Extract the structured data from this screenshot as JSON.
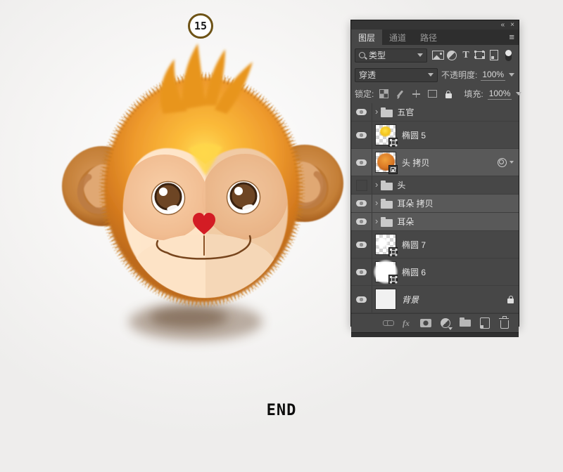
{
  "annotation": {
    "step_number": "15",
    "end_label": "END"
  },
  "panel": {
    "window_controls": {
      "collapse": "«",
      "close": "×",
      "menu": "≡"
    },
    "tabs": [
      {
        "label": "图层",
        "active": true
      },
      {
        "label": "通道",
        "active": false
      },
      {
        "label": "路径",
        "active": false
      }
    ],
    "filter": {
      "kind_label": "类型",
      "icons": [
        {
          "name": "pixel-filter"
        },
        {
          "name": "adjustment-filter"
        },
        {
          "name": "type-filter",
          "glyph": "T"
        },
        {
          "name": "shape-filter"
        },
        {
          "name": "smart-object-filter"
        },
        {
          "name": "filter-toggle"
        }
      ]
    },
    "blend": {
      "mode": "穿透",
      "opacity_label": "不透明度:",
      "opacity_value": "100%"
    },
    "lock": {
      "label": "锁定:",
      "icons": [
        "lock-transparent",
        "lock-paint",
        "lock-move",
        "lock-artboard",
        "lock-all"
      ],
      "fill_label": "填充:",
      "fill_value": "100%"
    },
    "layers": [
      {
        "name": "五官",
        "kind": "group",
        "visible": true,
        "selected": false
      },
      {
        "name": "椭圆 5",
        "kind": "layer",
        "visible": true,
        "selected": false,
        "thumb": "yellow-ellipse",
        "badge": "vector-mask"
      },
      {
        "name": "头 拷贝",
        "kind": "layer",
        "visible": true,
        "selected": true,
        "thumb": "monkey-head",
        "badge": "smart-object",
        "trailing": "smart-filter"
      },
      {
        "name": "头",
        "kind": "group",
        "visible": false,
        "selected": false
      },
      {
        "name": "耳朵 拷贝",
        "kind": "group",
        "visible": true,
        "selected": true
      },
      {
        "name": "耳朵",
        "kind": "group",
        "visible": true,
        "selected": true
      },
      {
        "name": "椭圆 7",
        "kind": "layer",
        "visible": true,
        "selected": false,
        "thumb": "white-ellipse-partial",
        "badge": "vector-mask"
      },
      {
        "name": "椭圆 6",
        "kind": "layer",
        "visible": true,
        "selected": false,
        "thumb": "white-ellipse-full",
        "badge": "vector-mask"
      },
      {
        "name": "背景",
        "kind": "background",
        "visible": true,
        "selected": false,
        "thumb": "white",
        "locked": true,
        "italic": true
      }
    ],
    "footer": {
      "fx_label": "fx",
      "icons": [
        "link-layers",
        "layer-style-fx",
        "add-mask",
        "adjustment-layer",
        "new-group",
        "new-layer",
        "delete-layer"
      ]
    }
  },
  "colors": {
    "panel_bg": "#474747",
    "panel_selected_row": "#595959",
    "fur_orange": "#e8942c",
    "fur_yellow": "#ffd94e",
    "face_cream": "#fde3c6",
    "socket_peach": "#f3c29a",
    "nose_red": "#d31c24",
    "badge_ring": "#6e5316"
  }
}
